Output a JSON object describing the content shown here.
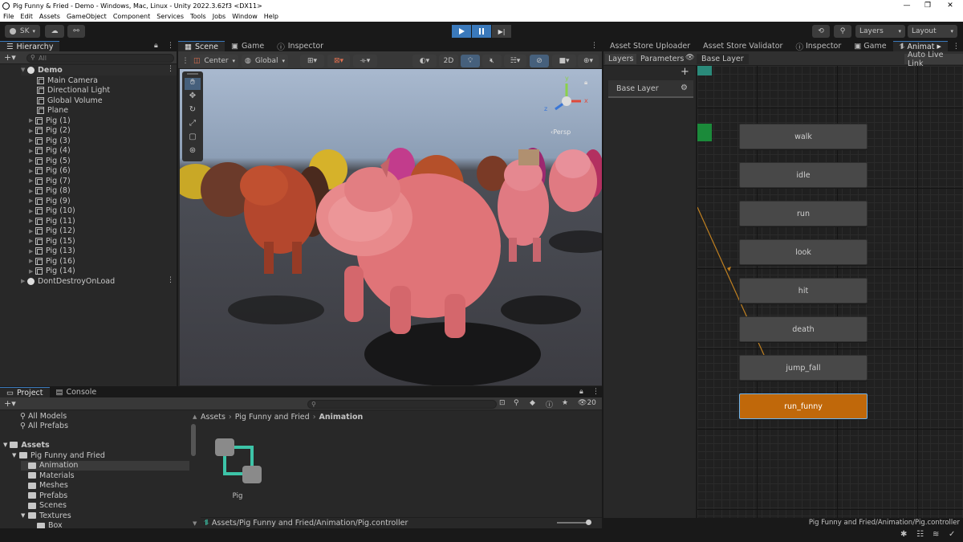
{
  "window": {
    "title": "Pig Funny & Fried - Demo - Windows, Mac, Linux - Unity 2022.3.62f3 <DX11>",
    "controls": [
      "—",
      "❐",
      "✕"
    ]
  },
  "menu": [
    "File",
    "Edit",
    "Assets",
    "GameObject",
    "Component",
    "Services",
    "Tools",
    "Jobs",
    "Window",
    "Help"
  ],
  "toolbar": {
    "account": "SK",
    "layers_label": "Layers",
    "layout_label": "Layout"
  },
  "hierarchy": {
    "tab": "Hierarchy",
    "search_placeholder": "All",
    "scene_name": "Demo",
    "children": [
      "Main Camera",
      "Directional Light",
      "Global Volume",
      "Plane"
    ],
    "pigs": [
      "Pig (1)",
      "Pig (2)",
      "Pig (3)",
      "Pig (4)",
      "Pig (5)",
      "Pig (6)",
      "Pig (7)",
      "Pig (8)",
      "Pig (9)",
      "Pig (10)",
      "Pig (11)",
      "Pig (12)",
      "Pig (15)",
      "Pig (13)",
      "Pig (16)",
      "Pig (14)"
    ],
    "dontdestroy": "DontDestroyOnLoad"
  },
  "center_tabs": [
    "Scene",
    "Game",
    "Inspector"
  ],
  "scene_toolbar": {
    "pivot": "Center",
    "space": "Global",
    "mode_2d": "2D"
  },
  "scene": {
    "gizmo_label": "‹Persp"
  },
  "right_tabs": [
    "Asset Store Uploader",
    "Asset Store Validator",
    "Inspector",
    "Game",
    "Animat"
  ],
  "animator": {
    "layers_tab": "Layers",
    "parameters_tab": "Parameters",
    "breadcrumb": "Base Layer",
    "auto_live_link": "Auto Live Link",
    "layer_name": "Base Layer",
    "states": [
      "walk",
      "idle",
      "run",
      "look",
      "hit",
      "death",
      "jump_fall",
      "run_funny"
    ],
    "default_state": "run_funny",
    "footer_path": "Pig Funny and Fried/Animation/Pig.controller"
  },
  "project": {
    "tabs": [
      "Project",
      "Console"
    ],
    "favorites": [
      "All Models",
      "All Prefabs"
    ],
    "assets_root": "Assets",
    "tree": [
      {
        "label": "Pig Funny and Fried",
        "level": 1
      },
      {
        "label": "Animation",
        "level": 2,
        "selected": true
      },
      {
        "label": "Materials",
        "level": 2
      },
      {
        "label": "Meshes",
        "level": 2
      },
      {
        "label": "Prefabs",
        "level": 2
      },
      {
        "label": "Scenes",
        "level": 2
      },
      {
        "label": "Textures",
        "level": 2
      },
      {
        "label": "Box",
        "level": 3
      }
    ],
    "breadcrumb": [
      "Assets",
      "Pig Funny and Fried",
      "Animation"
    ],
    "asset_name": "Pig",
    "visible_count": "20",
    "selected_path": "Assets/Pig Funny and Fried/Animation/Pig.controller"
  },
  "colors": {
    "accent_blue": "#3a79bb",
    "default_state": "#c0680a",
    "entry_state": "#1b8a3a",
    "any_state": "#2a8a7a"
  }
}
